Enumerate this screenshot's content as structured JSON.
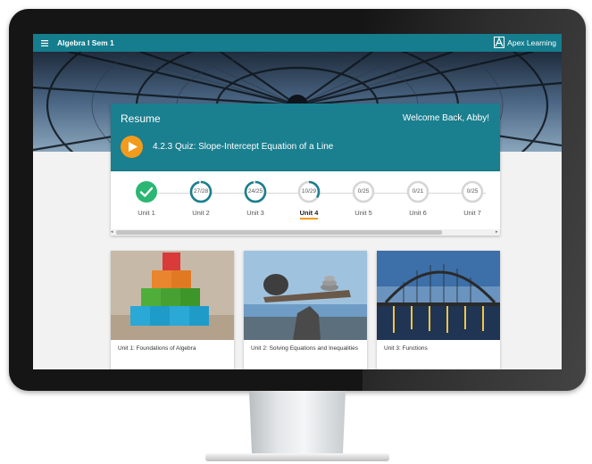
{
  "app": {
    "title": "Algebra I Sem 1",
    "brand": "Apex Learning"
  },
  "resume": {
    "heading": "Resume",
    "welcome": "Welcome Back, Abby!",
    "activity": "4.2.3 Quiz: Slope-Intercept Equation of a Line"
  },
  "units": [
    {
      "label": "Unit 1",
      "progress": "",
      "fraction": 1.0,
      "status": "complete"
    },
    {
      "label": "Unit 2",
      "progress": "27/28",
      "fraction": 0.964
    },
    {
      "label": "Unit 3",
      "progress": "24/25",
      "fraction": 0.96
    },
    {
      "label": "Unit 4",
      "progress": "10/29",
      "fraction": 0.345,
      "status": "current"
    },
    {
      "label": "Unit 5",
      "progress": "0/25",
      "fraction": 0
    },
    {
      "label": "Unit 6",
      "progress": "0/21",
      "fraction": 0
    },
    {
      "label": "Unit 7",
      "progress": "0/25",
      "fraction": 0
    }
  ],
  "cards": [
    {
      "title": "Unit 1: Foundations of Algebra"
    },
    {
      "title": "Unit 2: Solving Equations and Inequalities"
    },
    {
      "title": "Unit 3: Functions"
    }
  ],
  "colors": {
    "teal": "#1a7f8f",
    "appbar": "#157d8e",
    "accent": "#f39b1d",
    "complete": "#2bb673"
  },
  "icons": {
    "menu": "menu-icon",
    "play": "play-icon",
    "complete": "checkmark-icon",
    "brand": "apex-logo-icon"
  }
}
